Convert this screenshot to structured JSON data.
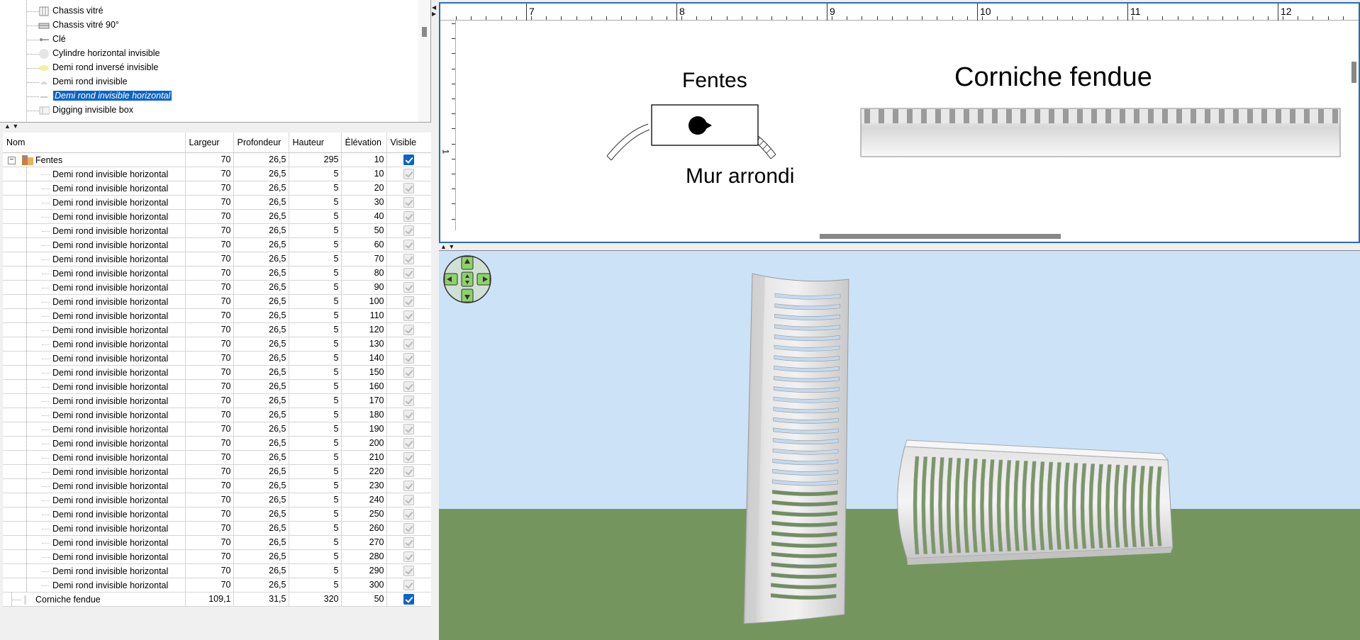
{
  "catalog": {
    "items": [
      {
        "label": "Chassis vitré",
        "icon": "glass-frame-icon"
      },
      {
        "label": "Chassis vitré 90°",
        "icon": "glass-frame-90-icon"
      },
      {
        "label": "Clé",
        "icon": "key-icon"
      },
      {
        "label": "Cylindre horizontal invisible",
        "icon": "cylinder-icon"
      },
      {
        "label": "Demi rond inversé invisible",
        "icon": "half-round-inverted-icon"
      },
      {
        "label": "Demi rond invisible",
        "icon": "half-round-icon"
      },
      {
        "label": "Demi rond invisible horizontal",
        "icon": "half-round-horizontal-icon",
        "selected": true
      },
      {
        "label": "Digging invisible box",
        "icon": "box-icon"
      }
    ]
  },
  "furniture": {
    "columns": [
      "Nom",
      "Largeur",
      "Profondeur",
      "Hauteur",
      "Élévation",
      "Visible"
    ],
    "group": {
      "name": "Fentes",
      "width": "70",
      "depth": "26,5",
      "height": "295",
      "elevation": "10",
      "visible": true
    },
    "child_name": "Demi rond invisible horizontal",
    "child_width": "70",
    "child_depth": "26,5",
    "child_height": "5",
    "child_elevations": [
      "10",
      "20",
      "30",
      "40",
      "50",
      "60",
      "70",
      "80",
      "90",
      "100",
      "110",
      "120",
      "130",
      "140",
      "150",
      "160",
      "170",
      "180",
      "190",
      "200",
      "210",
      "220",
      "230",
      "240",
      "250",
      "260",
      "270",
      "280",
      "290",
      "300"
    ],
    "last": {
      "name": "Corniche fendue",
      "width": "109,1",
      "depth": "31,5",
      "height": "320",
      "elevation": "50",
      "visible": true
    }
  },
  "plan": {
    "ruler_labels": [
      "7",
      "8",
      "9",
      "10",
      "11",
      "12"
    ],
    "vruler_label": "1",
    "label_fentes": "Fentes",
    "label_mur": "Mur arrondi",
    "label_corniche": "Corniche fendue"
  },
  "colors": {
    "selection": "#0a64c9",
    "plan_border": "#2a6cb5",
    "sky": "#cce2f7",
    "ground": "#74965e"
  },
  "view3d": {
    "nav_control": "navigation-arrows-icon"
  }
}
